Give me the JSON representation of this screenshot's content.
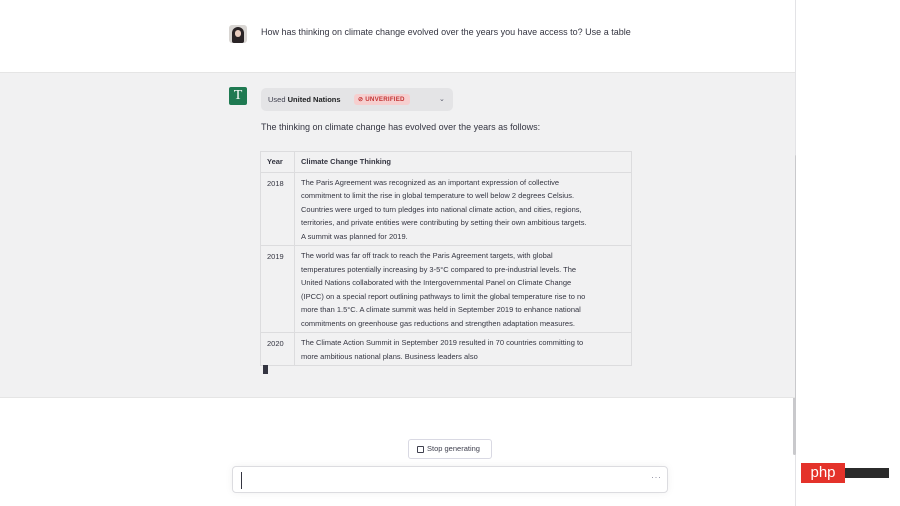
{
  "conversation": {
    "user_message": "How has thinking on climate change evolved over the years you have access to? Use a table",
    "assistant": {
      "avatar_letter": "T",
      "plugin": {
        "used_prefix": "Used",
        "name": "United Nations",
        "badge": "UNVERIFIED",
        "badge_color": "#c23434"
      },
      "intro": "The thinking on climate change has evolved over the years as follows:",
      "table": {
        "headers": [
          "Year",
          "Climate Change Thinking"
        ],
        "rows": [
          {
            "year": "2018",
            "lines": [
              "The Paris Agreement was recognized as an important expression of collective",
              "commitment to limit the rise in global temperature to well below 2 degrees Celsius.",
              "Countries were urged to turn pledges into national climate action, and cities, regions,",
              "territories, and private entities were contributing by setting their own ambitious targets.",
              "A summit was planned for 2019."
            ]
          },
          {
            "year": "2019",
            "lines": [
              "The world was far off track to reach the Paris Agreement targets, with global",
              "temperatures potentially increasing by 3-5°C compared to pre-industrial levels. The",
              "United Nations collaborated with the Intergovernmental Panel on Climate Change",
              "(IPCC) on a special report outlining pathways to limit the global temperature rise to no",
              "more than 1.5°C. A climate summit was held in September 2019 to enhance national",
              "commitments on greenhouse gas reductions and strengthen adaptation measures."
            ]
          },
          {
            "year": "2020",
            "lines": [
              "The Climate Action Summit in September 2019 resulted in 70 countries committing to",
              "more ambitious national plans. Business leaders also"
            ]
          }
        ]
      }
    }
  },
  "controls": {
    "stop_generating": "Stop generating",
    "input_value": "",
    "more_icon": "ellipsis-icon"
  },
  "watermark": {
    "text": "php"
  },
  "colors": {
    "plugin_avatar_bg": "#1f7a52",
    "assistant_bg": "#f1f1f2",
    "badge_bg": "#f6cfcf"
  }
}
